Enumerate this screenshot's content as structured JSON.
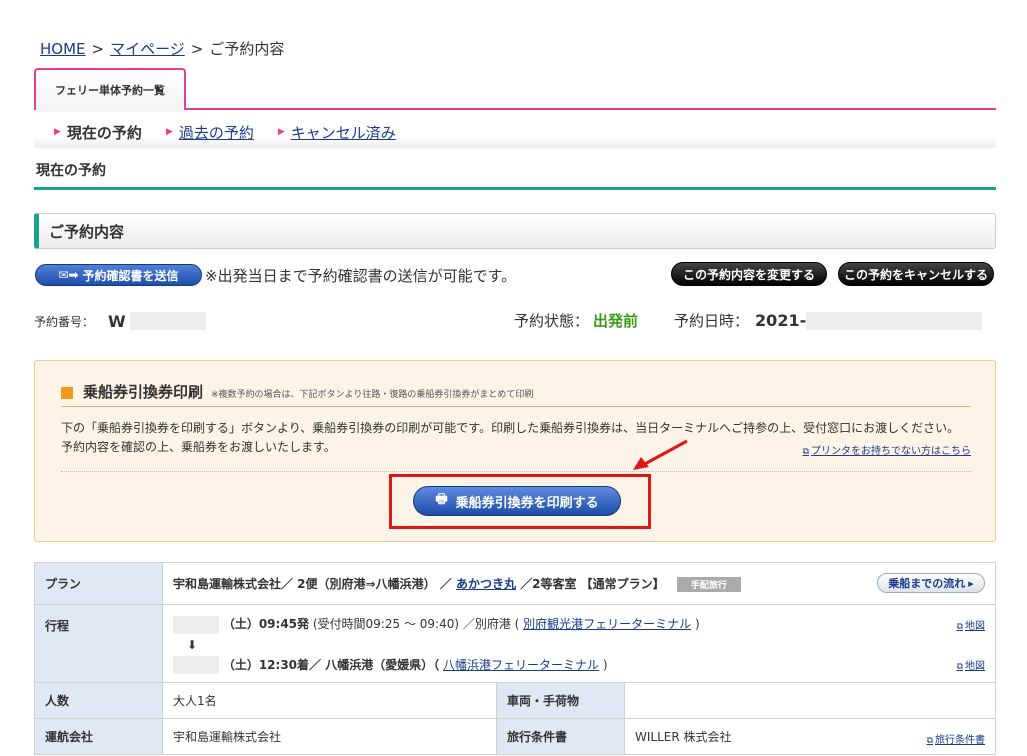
{
  "breadcrumb": {
    "home": "HOME",
    "mypage": "マイページ",
    "current": "ご予約内容",
    "sep": ">"
  },
  "tab": {
    "label": "フェリー単体予約一覧"
  },
  "subnav": {
    "current": "現在の予約",
    "past": "過去の予約",
    "cancelled": "キャンセル済み"
  },
  "section_title": "現在の予約",
  "content_header": "ご予約内容",
  "actions": {
    "send_label": "予約確認書を送信",
    "send_note": "※出発当日まで予約確認書の送信が可能です。",
    "change_label": "この予約内容を変更する",
    "cancel_label": "この予約をキャンセルする"
  },
  "booking": {
    "number_label": "予約番号：",
    "number": "W",
    "status_label": "予約状態：",
    "status": "出発前",
    "date_label": "予約日時：",
    "date": "2021-"
  },
  "print": {
    "title": "乗船券引換券印刷",
    "note": "※複数予約の場合は、下記ボタンより往路・復路の乗船券引換券がまとめて印刷",
    "desc_line1": "下の「乗船券引換券を印刷する」ボタンより、乗船券引換券の印刷が可能です。印刷した乗船券引換券は、当日ターミナルへご持参の上、受付窓口にお渡しください。",
    "desc_line2": "予約内容を確認の上、乗船券をお渡しいたします。",
    "printer_link": "プリンタをお持ちでない方はこちら",
    "button": "乗船券引換券を印刷する"
  },
  "table": {
    "plan_label": "プラン",
    "plan_prefix": "宇和島運輸株式会社／ 2便（別府港⇒八幡浜港） ／",
    "plan_ship": "あかつき丸",
    "plan_suffix": "／2等客室 【通常プラン】",
    "plan_tag": "手配旅行",
    "flow_button": "乗船までの流れ",
    "route_label": "行程",
    "dep_time": "（土）09:45発",
    "dep_detail": "(受付時間09:25 ～ 09:40) ／別府港 (",
    "dep_terminal": "別府観光港フェリーターミナル",
    "arr_time": "（土）12:30着／ 八幡浜港（愛媛県）（",
    "arr_terminal": "八幡浜港フェリーターミナル",
    "paren_close": ")",
    "map_link": "地図",
    "people_label": "人数",
    "people": "大人1名",
    "vehicle_label": "車両・手荷物",
    "vehicle": "",
    "operator_label": "運航会社",
    "operator": "宇和島運輸株式会社",
    "terms_label": "旅行条件書",
    "terms": "WILLER 株式会社",
    "terms_link": "旅行条件書"
  }
}
